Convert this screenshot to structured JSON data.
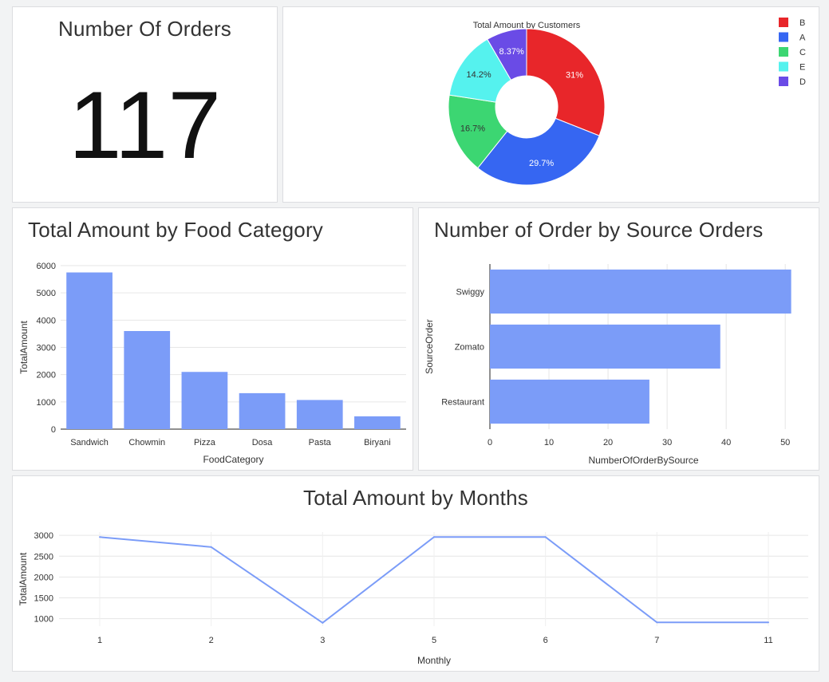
{
  "kpi": {
    "title": "Number Of Orders",
    "value": "117"
  },
  "colors": {
    "bar": "#7b9cf8",
    "grid": "#e6e6e6",
    "axis": "#222222"
  },
  "chart_data": [
    {
      "id": "pie",
      "type": "pie",
      "title": "Total Amount by Customers",
      "donut": true,
      "slices": [
        {
          "label": "B",
          "value": 31,
          "text": "31%",
          "color": "#e8262a"
        },
        {
          "label": "A",
          "value": 29.7,
          "text": "29.7%",
          "color": "#3666f2"
        },
        {
          "label": "C",
          "value": 16.7,
          "text": "16.7%",
          "color": "#3cd672"
        },
        {
          "label": "E",
          "value": 14.2,
          "text": "14.2%",
          "color": "#55f2ee"
        },
        {
          "label": "D",
          "value": 8.37,
          "text": "8.37%",
          "color": "#6a4be6"
        }
      ],
      "legend_position": "top-right"
    },
    {
      "id": "food",
      "type": "bar",
      "title": "Total Amount by Food Category",
      "categories": [
        "Sandwich",
        "Chowmin",
        "Pizza",
        "Dosa",
        "Pasta",
        "Biryani"
      ],
      "values": [
        5750,
        3600,
        2100,
        1320,
        1070,
        470
      ],
      "xlabel": "FoodCategory",
      "ylabel": "TotalAmount",
      "ylim": [
        0,
        6000
      ],
      "yticks": [
        0,
        1000,
        2000,
        3000,
        4000,
        5000,
        6000
      ],
      "grid": true
    },
    {
      "id": "source",
      "type": "bar",
      "orientation": "horizontal",
      "title": "Number of Order by Source Orders",
      "categories": [
        "Swiggy",
        "Zomato",
        "Restaurant"
      ],
      "values": [
        51,
        39,
        27
      ],
      "xlabel": "NumberOfOrderBySource",
      "ylabel": "SourceOrder",
      "xlim": [
        0,
        52
      ],
      "xticks": [
        0,
        10,
        20,
        30,
        40,
        50
      ],
      "grid": true
    },
    {
      "id": "months",
      "type": "line",
      "title": "Total Amount by Months",
      "categories": [
        "1",
        "2",
        "3",
        "5",
        "6",
        "7",
        "11"
      ],
      "values": [
        2960,
        2720,
        900,
        2960,
        2960,
        910,
        910
      ],
      "xlabel": "Monthly",
      "ylabel": "TotalAmount",
      "ylim": [
        820,
        3080
      ],
      "yticks": [
        1000,
        1500,
        2000,
        2500,
        3000
      ],
      "grid": true
    }
  ]
}
